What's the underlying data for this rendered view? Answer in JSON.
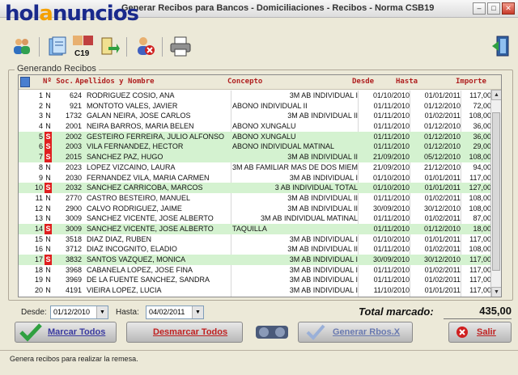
{
  "window": {
    "title": "Generar Recibos para Bancos - Domiciliaciones - Recibos - Norma CSB19"
  },
  "watermark": {
    "logo_text": "holanuncios"
  },
  "toolbar": {
    "c19_label": "C19"
  },
  "group": {
    "label": "Generando Recibos"
  },
  "table": {
    "headers": [
      "Nº Soc.",
      "Apellidos y Nombre",
      "Concepto",
      "Desde",
      "Hasta",
      "Importe"
    ],
    "rows": [
      {
        "n": "1",
        "f": "N",
        "soc": "624",
        "name": "RODRIGUEZ COSIO, ANA",
        "con": "3M AB INDIVIDUAL I",
        "r": true,
        "des": "01/10/2010",
        "has": "01/01/2011",
        "imp": "117,00"
      },
      {
        "n": "2",
        "f": "N",
        "soc": "921",
        "name": "MONTOTO VALES, JAVIER",
        "con": "ABONO INDIVIDUAL II",
        "r": false,
        "des": "01/11/2010",
        "has": "01/12/2010",
        "imp": "72,00"
      },
      {
        "n": "3",
        "f": "N",
        "soc": "1732",
        "name": "GALAN NEIRA, JOSE CARLOS",
        "con": "3M AB INDIVIDUAL II",
        "r": true,
        "des": "01/11/2010",
        "has": "01/02/2011",
        "imp": "108,00"
      },
      {
        "n": "4",
        "f": "N",
        "soc": "2001",
        "name": "NEIRA BARROS, MARIA BELEN",
        "con": "ABONO XUNGALU",
        "r": false,
        "des": "01/11/2010",
        "has": "01/12/2010",
        "imp": "36,00"
      },
      {
        "n": "5",
        "f": "S",
        "soc": "2002",
        "name": "GESTEIRO FERREIRA, JULIO ALFONSO",
        "con": "ABONO XUNGALU",
        "r": false,
        "des": "01/11/2010",
        "has": "01/12/2010",
        "imp": "36,00"
      },
      {
        "n": "6",
        "f": "S",
        "soc": "2003",
        "name": "VILA FERNANDEZ, HECTOR",
        "con": "ABONO INDIVIDUAL MATINAL",
        "r": false,
        "des": "01/11/2010",
        "has": "01/12/2010",
        "imp": "29,00"
      },
      {
        "n": "7",
        "f": "S",
        "soc": "2015",
        "name": "SANCHEZ PAZ, HUGO",
        "con": "3M AB INDIVIDUAL II",
        "r": true,
        "des": "21/09/2010",
        "has": "05/12/2010",
        "imp": "108,00"
      },
      {
        "n": "8",
        "f": "N",
        "soc": "2023",
        "name": "LOPEZ VIZCAINO, LAURA",
        "con": "3M AB FAMILIAR MAS DE DOS MIEM",
        "r": true,
        "des": "21/09/2010",
        "has": "21/12/2010",
        "imp": "94,00"
      },
      {
        "n": "9",
        "f": "N",
        "soc": "2030",
        "name": "FERNANDEZ VILA, MARIA CARMEN",
        "con": "3M AB INDIVIDUAL I",
        "r": true,
        "des": "01/10/2010",
        "has": "01/01/2011",
        "imp": "117,00"
      },
      {
        "n": "10",
        "f": "S",
        "soc": "2032",
        "name": "SANCHEZ CARRICOBA, MARCOS",
        "con": "3 AB INDIVIDUAL TOTAL",
        "r": true,
        "des": "01/10/2010",
        "has": "01/01/2011",
        "imp": "127,00"
      },
      {
        "n": "11",
        "f": "N",
        "soc": "2770",
        "name": "CASTRO BESTEIRO, MANUEL",
        "con": "3M AB INDIVIDUAL II",
        "r": true,
        "des": "01/11/2010",
        "has": "01/02/2011",
        "imp": "108,00"
      },
      {
        "n": "12",
        "f": "N",
        "soc": "2900",
        "name": "CALVO RODRIGUEZ, JAIME",
        "con": "3M AB INDIVIDUAL II",
        "r": true,
        "des": "30/09/2010",
        "has": "30/12/2010",
        "imp": "108,00"
      },
      {
        "n": "13",
        "f": "N",
        "soc": "3009",
        "name": "SANCHEZ VICENTE, JOSE ALBERTO",
        "con": "3M AB INDIVIDUAL MATINAL",
        "r": true,
        "des": "01/11/2010",
        "has": "01/02/2011",
        "imp": "87,00"
      },
      {
        "n": "14",
        "f": "S",
        "soc": "3009",
        "name": "SANCHEZ VICENTE, JOSE ALBERTO",
        "con": "TAQUILLA",
        "r": false,
        "des": "01/11/2010",
        "has": "01/12/2010",
        "imp": "18,00"
      },
      {
        "n": "15",
        "f": "N",
        "soc": "3518",
        "name": "DIAZ DIAZ, RUBEN",
        "con": "3M AB INDIVIDUAL I",
        "r": true,
        "des": "01/10/2010",
        "has": "01/01/2011",
        "imp": "117,00"
      },
      {
        "n": "16",
        "f": "N",
        "soc": "3712",
        "name": "DIAZ INCOGNITO, ELADIO",
        "con": "3M AB INDIVIDUAL II",
        "r": true,
        "des": "01/11/2010",
        "has": "01/02/2011",
        "imp": "108,00"
      },
      {
        "n": "17",
        "f": "S",
        "soc": "3832",
        "name": "SANTOS VAZQUEZ, MONICA",
        "con": "3M AB INDIVIDUAL I",
        "r": true,
        "des": "30/09/2010",
        "has": "30/12/2010",
        "imp": "117,00"
      },
      {
        "n": "18",
        "f": "N",
        "soc": "3968",
        "name": "CABANELA LOPEZ, JOSE FINA",
        "con": "3M AB INDIVIDUAL I",
        "r": true,
        "des": "01/11/2010",
        "has": "01/02/2011",
        "imp": "117,00"
      },
      {
        "n": "19",
        "f": "N",
        "soc": "3969",
        "name": "DE LA FUENTE SANCHEZ, SANDRA",
        "con": "3M AB INDIVIDUAL I",
        "r": true,
        "des": "01/11/2010",
        "has": "01/02/2011",
        "imp": "117,00"
      },
      {
        "n": "20",
        "f": "N",
        "soc": "4191",
        "name": "VIEIRA LOPEZ, LUCIA",
        "con": "3M AB INDIVIDUAL I",
        "r": true,
        "des": "11/10/2010",
        "has": "01/01/2011",
        "imp": "117,00"
      }
    ]
  },
  "filters": {
    "desde_label": "Desde:",
    "desde_value": "01/12/2010",
    "hasta_label": "Hasta:",
    "hasta_value": "04/02/2011"
  },
  "totals": {
    "label": "Total marcado:",
    "value": "435,00"
  },
  "buttons": {
    "marcar": "Marcar Todos",
    "desmarcar": "Desmarcar Todos",
    "generar": "Generar Rbos.X",
    "salir": "Salir"
  },
  "status": {
    "text": "Genera recibos para realizar la remesa."
  },
  "colors": {
    "selected_row": "#d4f2d0",
    "flag_s": "#e02020",
    "header_text": "#b02020",
    "logo_blue": "#1a2a8c",
    "logo_orange": "#f5a000"
  }
}
